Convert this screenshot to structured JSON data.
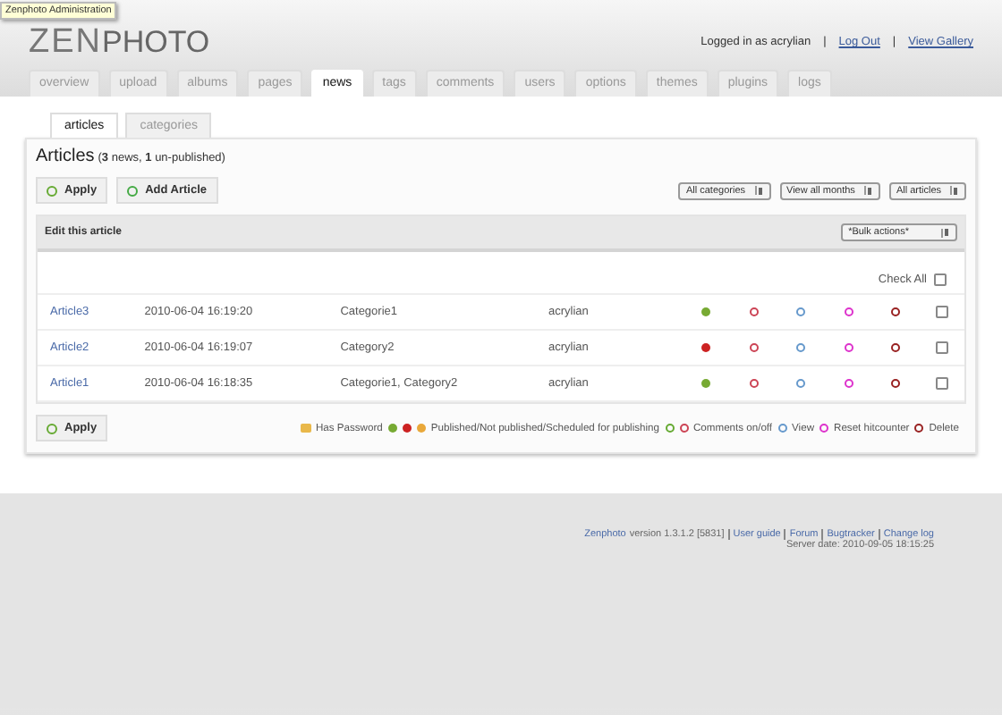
{
  "tooltip": "Zenphoto Administration",
  "logo": {
    "light": "ZEN",
    "bold": "PHOTO"
  },
  "user_bar": {
    "logged_in": "Logged in as acrylian",
    "links": [
      "Log Out",
      "View Gallery"
    ],
    "separator": "|"
  },
  "tabs": [
    {
      "label": "overview",
      "selected": false
    },
    {
      "label": "upload",
      "selected": false
    },
    {
      "label": "albums",
      "selected": false
    },
    {
      "label": "pages",
      "selected": false
    },
    {
      "label": "news",
      "selected": true
    },
    {
      "label": "tags",
      "selected": false
    },
    {
      "label": "comments",
      "selected": false
    },
    {
      "label": "users",
      "selected": false
    },
    {
      "label": "options",
      "selected": false
    },
    {
      "label": "themes",
      "selected": false
    },
    {
      "label": "plugins",
      "selected": false
    },
    {
      "label": "logs",
      "selected": false
    }
  ],
  "subtabs": [
    {
      "label": "articles",
      "selected": true
    },
    {
      "label": "categories",
      "selected": false
    }
  ],
  "heading": {
    "title": "Articles",
    "summary": "(**3** news, **1** un-published)"
  },
  "buttons": {
    "apply": "Apply",
    "add": "Add Article",
    "apply_bottom": "Apply"
  },
  "filters": [
    "All categories",
    "View all months",
    "All articles"
  ],
  "panel": {
    "title": "Edit this article",
    "bulk": "*Bulk actions*",
    "check_all": "Check All",
    "check_all_checked": false
  },
  "rows": [
    {
      "title": "Article3",
      "date": "2010-06-04 16:19:20",
      "categories": "Categorie1",
      "author": "acrylian",
      "published": true,
      "checked": false
    },
    {
      "title": "Article2",
      "date": "2010-06-04 16:19:07",
      "categories": "Category2",
      "author": "acrylian",
      "published": false,
      "checked": false
    },
    {
      "title": "Article1",
      "date": "2010-06-04 16:18:35",
      "categories": "Categorie1, Category2",
      "author": "acrylian",
      "published": true,
      "checked": false
    }
  ],
  "legend": {
    "password": "Has Password",
    "publish": "Published/Not published/Scheduled for publishing",
    "comments": "Comments on/off",
    "view": "View",
    "reset": "Reset hitcounter",
    "delete": "Delete"
  },
  "footer": {
    "brand": "Zenphoto",
    "version": "version 1.3.1.2 [5831]",
    "links": [
      "User guide",
      "Forum",
      "Bugtracker",
      "Change log"
    ],
    "server_date": "Server date: 2010-09-05 18:15:25"
  }
}
